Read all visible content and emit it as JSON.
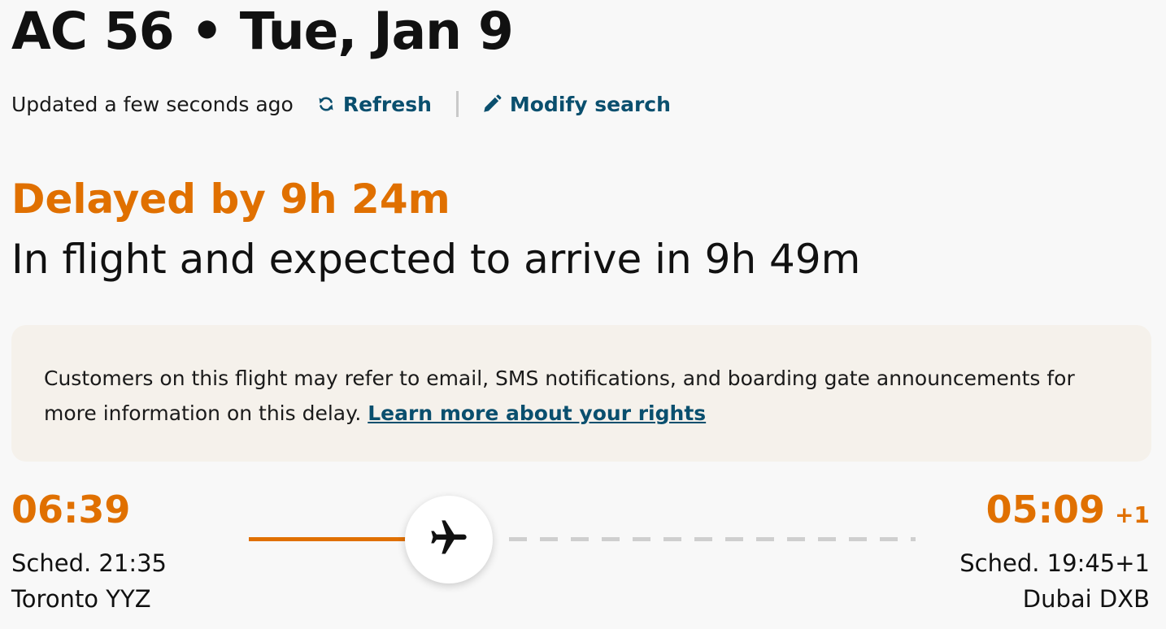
{
  "flight": {
    "title": "AC 56 • Tue, Jan 9"
  },
  "update": {
    "updated_text": "Updated a few seconds ago",
    "refresh_label": "Refresh",
    "modify_label": "Modify search"
  },
  "status": {
    "delay_text": "Delayed by 9h 24m",
    "detail_text": "In flight and expected to arrive in 9h 49m",
    "accent_color": "#e07000"
  },
  "notice": {
    "text": "Customers on this flight may refer to email, SMS notifications, and boarding gate announcements for more information on this delay. ",
    "link_label": "Learn more about your rights",
    "link_color": "#0a4f6e"
  },
  "departure": {
    "actual_time": "06:39",
    "scheduled": "Sched. 21:35",
    "city": "Toronto YYZ"
  },
  "arrival": {
    "actual_time": "05:09",
    "day_offset": "+1",
    "scheduled": "Sched. 19:45+1",
    "city": "Dubai DXB"
  },
  "icons": {
    "refresh": "refresh-icon",
    "modify": "pencil-icon",
    "plane": "airplane-icon"
  }
}
